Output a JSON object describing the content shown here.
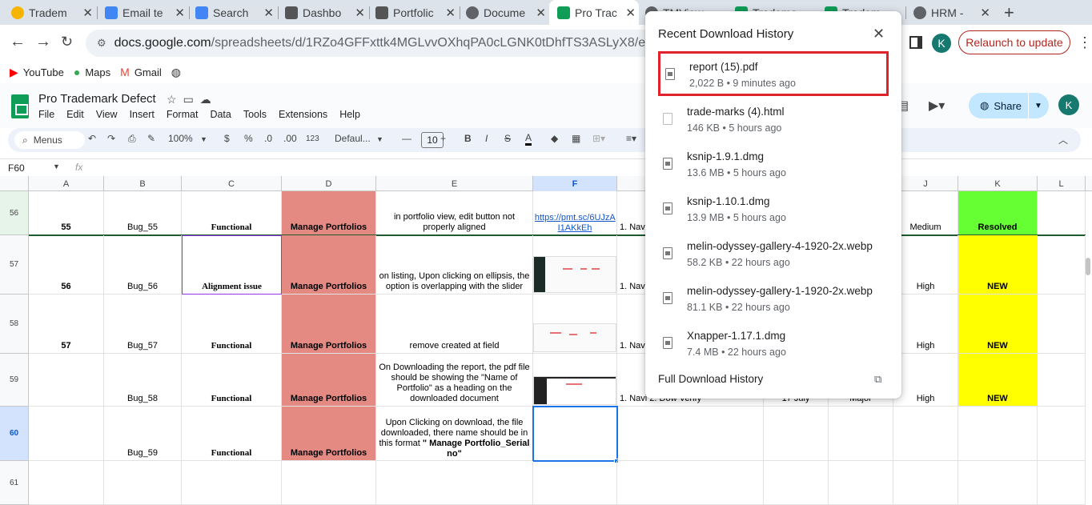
{
  "browser": {
    "tabs": [
      {
        "label": "Tradem",
        "color": "#f4b400"
      },
      {
        "label": "Email te",
        "color": "#4285f4"
      },
      {
        "label": "Search",
        "color": "#4285f4"
      },
      {
        "label": "Dashbo",
        "color": "#555555"
      },
      {
        "label": "Portfolic",
        "color": "#555555"
      },
      {
        "label": "Docume",
        "color": "#5f6368"
      },
      {
        "label": "Pro Trac",
        "color": "#0f9d58"
      },
      {
        "label": "TMView",
        "color": "#5f6368"
      },
      {
        "label": "Tradema",
        "color": "#0f9d58"
      },
      {
        "label": "Tradem",
        "color": "#0f9d58"
      },
      {
        "label": "HRM -",
        "color": "#5f6368"
      }
    ],
    "url_host": "docs.google.com",
    "url_path": "/spreadsheets/d/1RZo4GFFxttk4MGLvvOXhqPA0cLGNK0tDhfTS3ASLyX8/edit?gid=8",
    "profile_initial": "K",
    "relaunch_label": "Relaunch to update",
    "bookmarks": [
      {
        "label": "YouTube",
        "icon": "youtube-icon"
      },
      {
        "label": "Maps",
        "icon": "maps-icon"
      },
      {
        "label": "Gmail",
        "icon": "gmail-icon"
      },
      {
        "label": "",
        "icon": "globe-icon"
      }
    ]
  },
  "sheets": {
    "title": "Pro Trademark Defect",
    "menu": [
      "File",
      "Edit",
      "View",
      "Insert",
      "Format",
      "Data",
      "Tools",
      "Extensions",
      "Help"
    ],
    "share_label": "Share",
    "user_initial": "K",
    "toolbar": {
      "menus_search": "Menus",
      "zoom": "100%",
      "currency": "$",
      "percent": "%",
      "dec_less": ".0",
      "dec_more": ".00",
      "number_fmt": "123",
      "font": "Defaul...",
      "font_size": "10",
      "bold": "B",
      "italic": "I",
      "strike": "S",
      "text_color": "A"
    },
    "name_box": "F60",
    "fx": "fx",
    "columns": [
      "A",
      "B",
      "C",
      "D",
      "E",
      "F",
      "G",
      "H",
      "I",
      "J",
      "K",
      "L"
    ],
    "selected_column": "F",
    "rows": [
      {
        "num": "56",
        "a": "55",
        "b": "Bug_55",
        "c": "Functional",
        "d": "Manage Portfolios",
        "e": "in portfolio view, edit button not properly aligned",
        "f": "https://pmt.sc/6UJzA I1AKkEh",
        "g": "1. Navi View 2. verif",
        "j": "Medium",
        "k": "Resolved"
      },
      {
        "num": "57",
        "a": "56",
        "b": "Bug_56",
        "c": "Alignment issue",
        "d": "Manage Portfolios",
        "e": "on listing, Upon clicking on ellipsis, the option is overlapping with the slider",
        "f": "",
        "g": "1. Navi 2. Verif",
        "j": "High",
        "k": "NEW"
      },
      {
        "num": "58",
        "a": "57",
        "b": "Bug_57",
        "c": "Functional",
        "d": "Manage Portfolios",
        "e": "remove created at field",
        "f": "",
        "g": "1. Navi 2. Verif",
        "j": "High",
        "k": "NEW"
      },
      {
        "num": "59",
        "a": "",
        "b": "Bug_58",
        "c": "Functional",
        "d": "Manage Portfolios",
        "e": "On Downloading the report, the pdf file should be showing the \"Name of Portfolio\" as a heading on the downloaded document",
        "f": "",
        "g": "1. Navi 2. Dow Verify",
        "h": "17 July",
        "i": "Major",
        "j": "High",
        "k": "NEW"
      },
      {
        "num": "60",
        "a": "",
        "b": "Bug_59",
        "c": "Functional",
        "d": "Manage Portfolios",
        "e_plain": "Upon Clicking on download, the file downloaded, there name should be in this format ",
        "e_bold": "\" Manage Portfolio_Serial no\"",
        "f": "",
        "g": "",
        "j": "",
        "k": ""
      },
      {
        "num": "61"
      }
    ]
  },
  "downloads": {
    "title": "Recent Download History",
    "items": [
      {
        "name": "report (15).pdf",
        "meta": "2,022 B • 9 minutes ago"
      },
      {
        "name": "trade-marks (4).html",
        "meta": "146 KB • 5 hours ago"
      },
      {
        "name": "ksnip-1.9.1.dmg",
        "meta": "13.6 MB • 5 hours ago"
      },
      {
        "name": "ksnip-1.10.1.dmg",
        "meta": "13.9 MB • 5 hours ago"
      },
      {
        "name": "melin-odyssey-gallery-4-1920-2x.webp",
        "meta": "58.2 KB • 22 hours ago"
      },
      {
        "name": "melin-odyssey-gallery-1-1920-2x.webp",
        "meta": "81.1 KB • 22 hours ago"
      },
      {
        "name": "Xnapper-1.17.1.dmg",
        "meta": "7.4 MB • 22 hours ago"
      }
    ],
    "full_history_label": "Full Download History"
  },
  "colors": {
    "pink": "#e58983",
    "resolved_green": "#66ff33",
    "new_yellow": "#ffff00",
    "highlight_red": "#e0232a"
  }
}
